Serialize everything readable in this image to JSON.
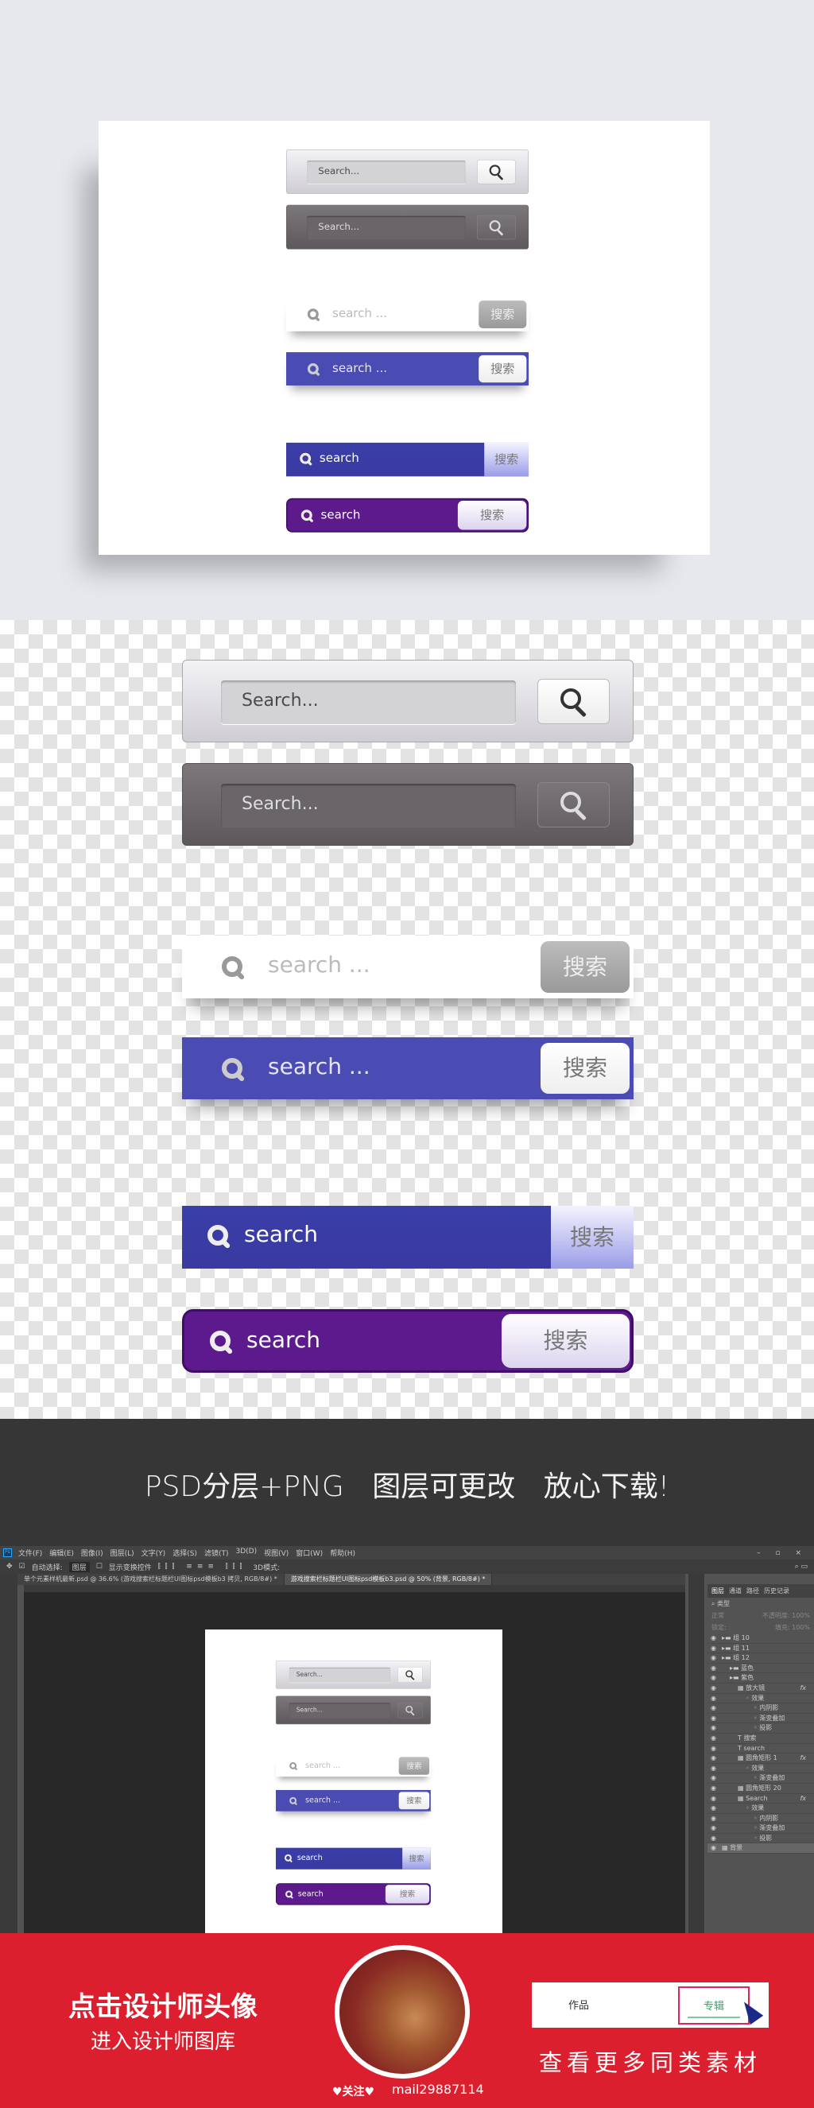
{
  "bars": {
    "gray_light": {
      "placeholder": "Search...",
      "icon": "magnifier-icon"
    },
    "gray_dark": {
      "placeholder": "Search...",
      "icon": "magnifier-icon"
    },
    "white": {
      "placeholder": "search ...",
      "button": "搜索"
    },
    "blue": {
      "placeholder": "search ...",
      "button": "搜索"
    },
    "blue_flat": {
      "placeholder": "search",
      "button": "搜索"
    },
    "purple": {
      "placeholder": "search",
      "button": "搜索"
    }
  },
  "colors": {
    "blue": "#4a4cb4",
    "blue_flat": "#3a3ea8",
    "purple": "#5c1a8c",
    "banner_red": "#dc1f2e",
    "dark_band": "#363636"
  },
  "slogan": "PSD分层+PNG 图层可更改 放心下载!",
  "photoshop": {
    "logo": "Ps",
    "menu": [
      "文件(F)",
      "编辑(E)",
      "图像(I)",
      "图层(L)",
      "文字(Y)",
      "选择(S)",
      "滤镜(T)",
      "3D(D)",
      "视图(V)",
      "窗口(W)",
      "帮助(H)"
    ],
    "options": {
      "auto_select": "自动选择:",
      "auto_select_value": "图层",
      "show_transform": "显示变换控件",
      "mode_3d": "3D模式:"
    },
    "doc_tabs": [
      "单个元素样机最新.psd @ 36.6% (游戏搜索栏标题栏UI图标psd模板b3 拷贝, RGB/8#) *",
      "游戏搜索栏标题栏UI图标psd模板b3.psd @ 50% (背景, RGB/8#) *"
    ],
    "panel_tabs": [
      "图层",
      "通道",
      "路径",
      "历史记录"
    ],
    "filter": "类型",
    "blend": "正常",
    "opacity": "不透明度: 100%",
    "lock": "锁定:",
    "fill": "填充: 100%",
    "layers": [
      {
        "name": "组 10",
        "level": 0,
        "kind": "group"
      },
      {
        "name": "组 11",
        "level": 0,
        "kind": "group"
      },
      {
        "name": "组 12",
        "level": 0,
        "kind": "group"
      },
      {
        "name": "蓝色",
        "level": 1,
        "kind": "group"
      },
      {
        "name": "紫色",
        "level": 1,
        "kind": "group"
      },
      {
        "name": "放大镜",
        "level": 2,
        "kind": "layer",
        "fx": true
      },
      {
        "name": "效果",
        "level": 3,
        "kind": "effect"
      },
      {
        "name": "内阴影",
        "level": 4,
        "kind": "effect"
      },
      {
        "name": "渐变叠加",
        "level": 4,
        "kind": "effect"
      },
      {
        "name": "投影",
        "level": 4,
        "kind": "effect"
      },
      {
        "name": "搜索",
        "level": 2,
        "kind": "text"
      },
      {
        "name": "search",
        "level": 2,
        "kind": "text"
      },
      {
        "name": "圆角矩形 1",
        "level": 2,
        "kind": "layer",
        "fx": true
      },
      {
        "name": "效果",
        "level": 3,
        "kind": "effect"
      },
      {
        "name": "渐变叠加",
        "level": 4,
        "kind": "effect"
      },
      {
        "name": "圆角矩形 20",
        "level": 2,
        "kind": "layer"
      },
      {
        "name": "Search",
        "level": 2,
        "kind": "layer",
        "fx": true
      },
      {
        "name": "效果",
        "level": 3,
        "kind": "effect"
      },
      {
        "name": "内阴影",
        "level": 4,
        "kind": "effect"
      },
      {
        "name": "渐变叠加",
        "level": 4,
        "kind": "effect"
      },
      {
        "name": "投影",
        "level": 4,
        "kind": "effect"
      },
      {
        "name": "背景",
        "level": 0,
        "kind": "background"
      }
    ]
  },
  "banner": {
    "line1": "点击设计师头像",
    "line2": "进入设计师图库",
    "follow": "♥关注♥",
    "username": "mail29887114",
    "tab_works": "作品",
    "tab_album": "专辑",
    "more": "查看更多同类素材"
  }
}
